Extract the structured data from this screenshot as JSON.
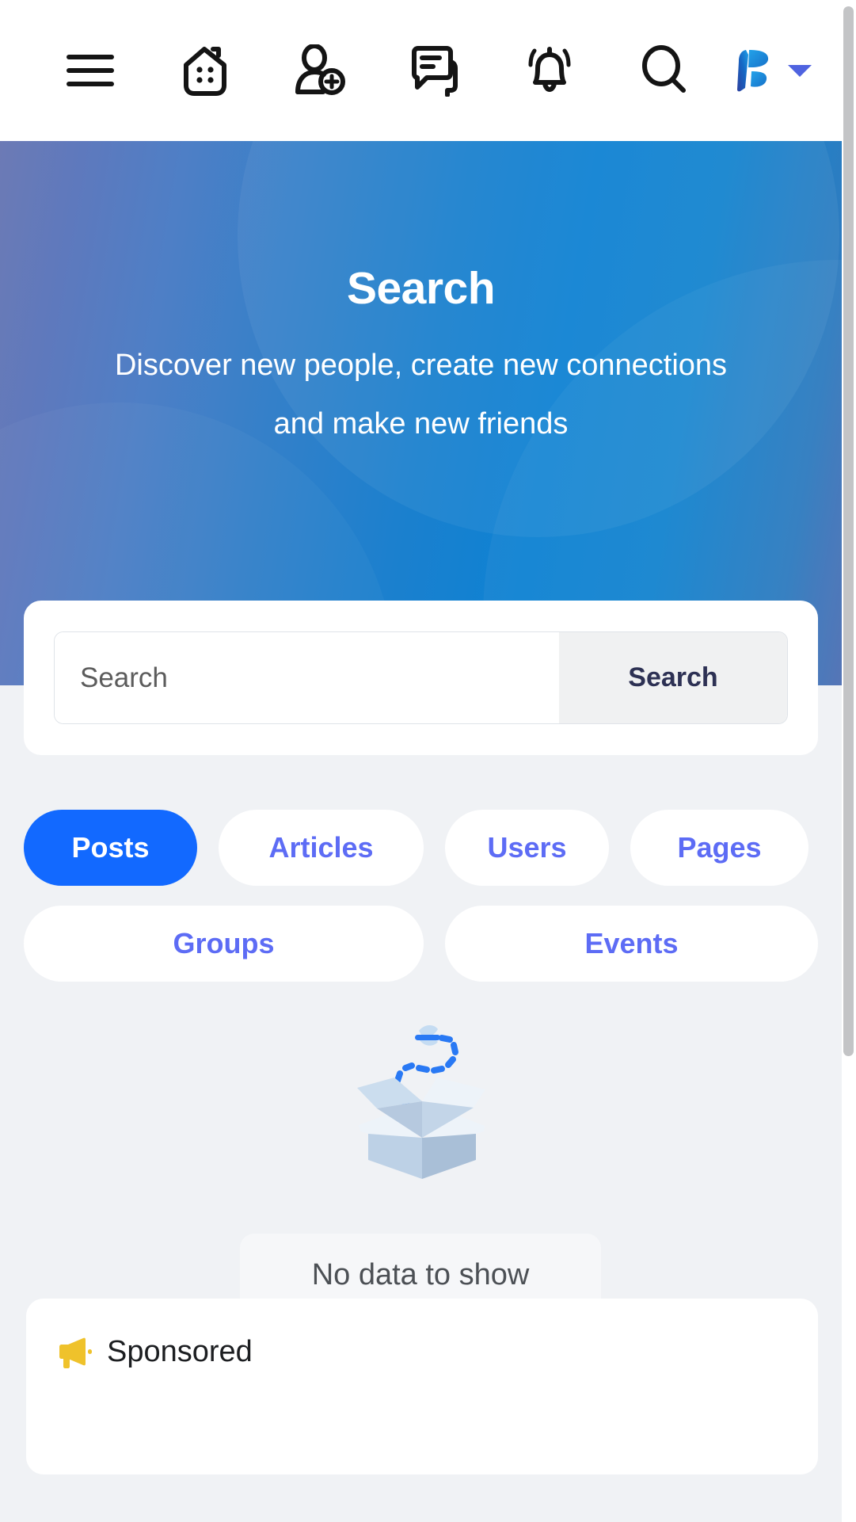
{
  "topbar": {
    "icons": [
      {
        "name": "menu-icon",
        "label": "Menu"
      },
      {
        "name": "home-icon",
        "label": "Home"
      },
      {
        "name": "add-friend-icon",
        "label": "Friend requests"
      },
      {
        "name": "messages-icon",
        "label": "Messages"
      },
      {
        "name": "notifications-icon",
        "label": "Notifications"
      },
      {
        "name": "search-icon",
        "label": "Search"
      }
    ],
    "avatar": {
      "name": "avatar",
      "label": "Profile"
    },
    "caret": {
      "name": "chevron-down-icon",
      "label": "Open account menu"
    }
  },
  "hero": {
    "title": "Search",
    "subtitle": "Discover new people, create new connections and make new friends",
    "gradient_from": "#6C7AB5",
    "gradient_to": "#0E82D3"
  },
  "search": {
    "placeholder": "Search",
    "value": "",
    "button_label": "Search"
  },
  "tabs": [
    {
      "label": "Posts",
      "active": true
    },
    {
      "label": "Articles",
      "active": false
    },
    {
      "label": "Users",
      "active": false
    },
    {
      "label": "Pages",
      "active": false
    },
    {
      "label": "Groups",
      "active": false
    },
    {
      "label": "Events",
      "active": false
    }
  ],
  "empty_state": {
    "message": "No data to show",
    "illustration": "empty-box-illustration"
  },
  "sponsored": {
    "label": "Sponsored",
    "icon": "megaphone-icon",
    "icon_color": "#EFC22B"
  },
  "colors": {
    "accent_blue": "#1269FF",
    "tab_text": "#5D6CF5",
    "page_background": "#F0F2F5",
    "card_background": "#FFFFFF",
    "sponsored_gold": "#EFC22B"
  }
}
